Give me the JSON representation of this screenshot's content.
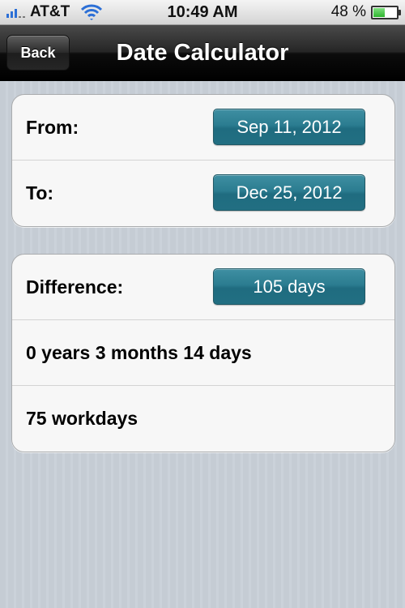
{
  "status_bar": {
    "carrier": "AT&T",
    "time": "10:49 AM",
    "battery_percent_label": "48 %",
    "battery_level": 0.48,
    "icons": [
      "signal-bars-icon",
      "wifi-icon",
      "battery-icon"
    ]
  },
  "nav_bar": {
    "back_label": "Back",
    "title": "Date Calculator"
  },
  "dates": {
    "from_label": "From:",
    "from_value": "Sep 11, 2012",
    "to_label": "To:",
    "to_value": "Dec 25, 2012"
  },
  "results": {
    "difference_label": "Difference:",
    "difference_value": "105 days",
    "breakdown": "0 years 3 months 14 days",
    "workdays": "75 workdays"
  },
  "colors": {
    "accent_button": "#2b7c90",
    "nav_bar": "#1a1a1a",
    "background": "#c5ccd4"
  }
}
